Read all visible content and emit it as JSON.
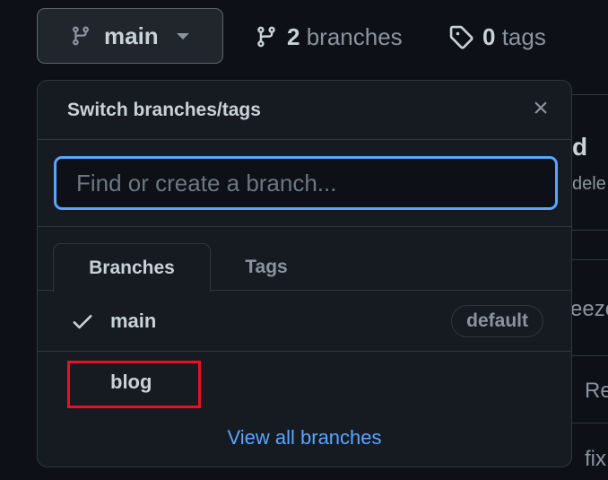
{
  "branch_button": {
    "label": "main",
    "icon": "git-branch-icon"
  },
  "repo_meta": {
    "branches_count": "2",
    "branches_label": "branches",
    "tags_count": "0",
    "tags_label": "tags"
  },
  "background_fragments": [
    "d",
    "dele",
    "eezo",
    "Re",
    "fix"
  ],
  "popup": {
    "title": "Switch branches/tags",
    "close_icon": "close-icon",
    "search_placeholder": "Find or create a branch...",
    "tabs": [
      {
        "label": "Branches",
        "active": true
      },
      {
        "label": "Tags",
        "active": false
      }
    ],
    "branches": [
      {
        "name": "main",
        "selected": true,
        "badge": "default"
      },
      {
        "name": "blog",
        "selected": false,
        "highlighted": true
      }
    ],
    "view_all": "View all branches"
  },
  "colors": {
    "accent": "#58a6ff",
    "highlight_box": "#e5131d"
  }
}
